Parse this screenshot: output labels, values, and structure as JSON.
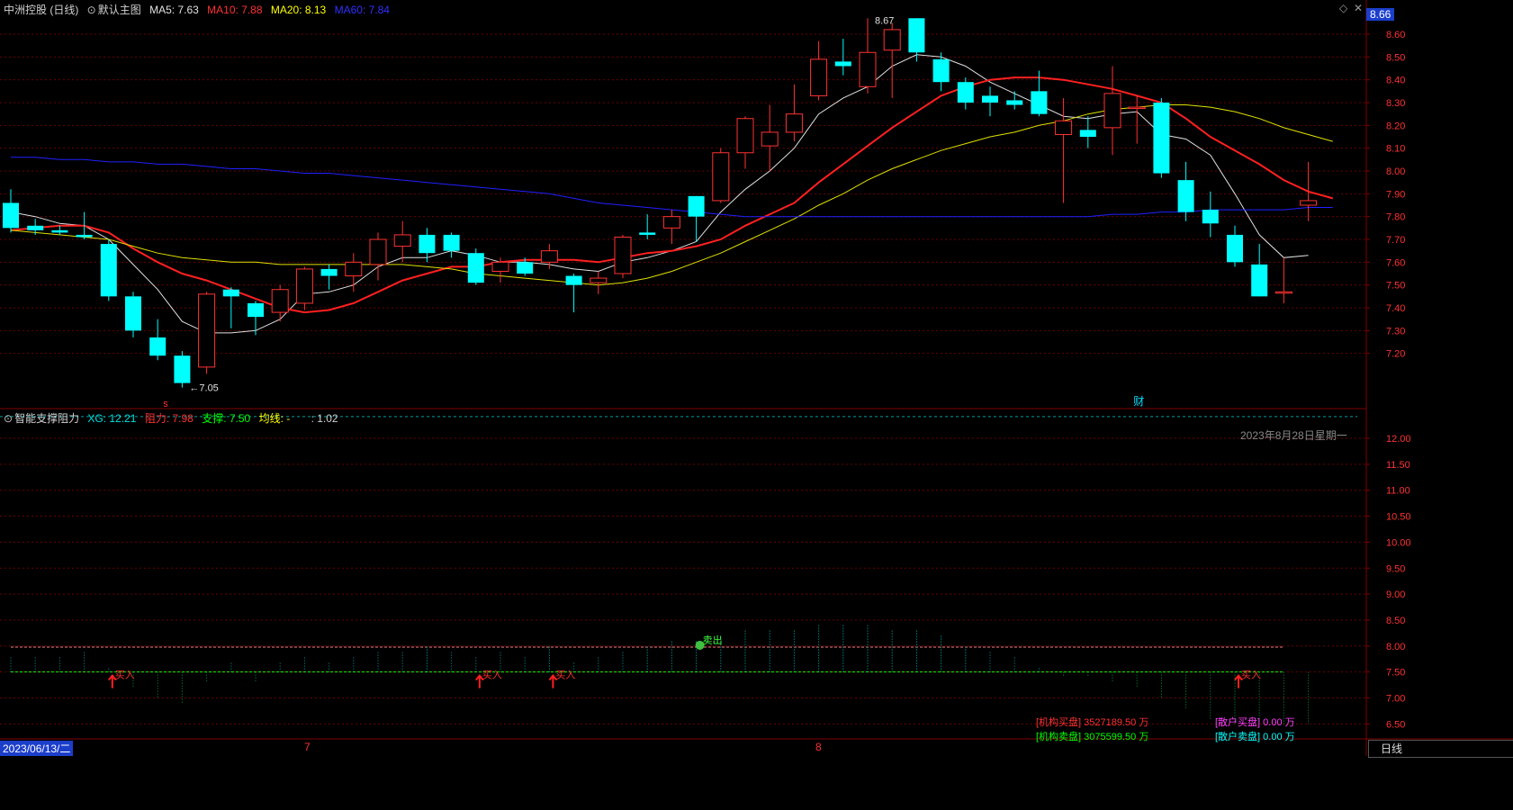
{
  "header": {
    "stock_name": "中洲控股 (日线)",
    "main_chart_label": "默认主图",
    "ma5": "MA5: 7.63",
    "ma10": "MA10: 7.88",
    "ma20": "MA20: 8.13",
    "ma60": "MA60: 7.84",
    "top_right_price": "8.66"
  },
  "indicator": {
    "name": "智能支撑阻力",
    "xg": "XG: 12.21",
    "resistance": "阻力: 7.98",
    "support": "支撑: 7.50",
    "avg": "均线: -",
    "extra": ": 1.02",
    "date_label": "2023年8月28日星期一"
  },
  "bottom": {
    "start_date": "2023/06/13/二",
    "month_7": "7",
    "month_8": "8",
    "period_button": "日线"
  },
  "stats": {
    "inst_buy": "[机构买盘] 3527189.50 万",
    "inst_sell": "[机构卖盘] 3075599.50 万",
    "retail_buy": "[散户买盘] 0.00 万",
    "retail_sell": "[散户卖盘] 0.00 万"
  },
  "annotations": {
    "high": "8.67",
    "low": "7.05",
    "buy": "买入",
    "sell": "卖出",
    "cai": "财",
    "s_mark": "s"
  },
  "colors": {
    "up": "#ff3232",
    "down": "#00ffff",
    "ma5": "#e0e0e0",
    "ma10": "#ff2020",
    "ma20": "#e0e000",
    "ma60": "#2020ff",
    "grid": "#6a0000"
  },
  "chart_data": [
    {
      "type": "candlestick",
      "title": "中洲控股 (日线)",
      "y_ticks": [
        7.2,
        7.3,
        7.4,
        7.5,
        7.6,
        7.7,
        7.8,
        7.9,
        8.0,
        8.1,
        8.2,
        8.3,
        8.4,
        8.5,
        8.6
      ],
      "ylim": [
        7.0,
        8.7
      ],
      "candles": [
        [
          7.86,
          7.75,
          7.92,
          7.73
        ],
        [
          7.76,
          7.74,
          7.79,
          7.72
        ],
        [
          7.74,
          7.73,
          7.76,
          7.72
        ],
        [
          7.72,
          7.71,
          7.82,
          7.7
        ],
        [
          7.68,
          7.45,
          7.7,
          7.43
        ],
        [
          7.45,
          7.3,
          7.47,
          7.27
        ],
        [
          7.27,
          7.19,
          7.35,
          7.17
        ],
        [
          7.19,
          7.07,
          7.21,
          7.05
        ],
        [
          7.14,
          7.46,
          7.47,
          7.11
        ],
        [
          7.48,
          7.45,
          7.49,
          7.31
        ],
        [
          7.42,
          7.36,
          7.43,
          7.28
        ],
        [
          7.38,
          7.48,
          7.5,
          7.34
        ],
        [
          7.42,
          7.57,
          7.58,
          7.39
        ],
        [
          7.57,
          7.54,
          7.59,
          7.48
        ],
        [
          7.54,
          7.6,
          7.64,
          7.47
        ],
        [
          7.59,
          7.7,
          7.73,
          7.52
        ],
        [
          7.67,
          7.72,
          7.78,
          7.6
        ],
        [
          7.72,
          7.64,
          7.75,
          7.6
        ],
        [
          7.72,
          7.65,
          7.73,
          7.62
        ],
        [
          7.64,
          7.51,
          7.66,
          7.5
        ],
        [
          7.56,
          7.6,
          7.62,
          7.51
        ],
        [
          7.6,
          7.55,
          7.62,
          7.54
        ],
        [
          7.6,
          7.65,
          7.68,
          7.57
        ],
        [
          7.54,
          7.5,
          7.55,
          7.38
        ],
        [
          7.51,
          7.53,
          7.56,
          7.46
        ],
        [
          7.55,
          7.71,
          7.72,
          7.53
        ],
        [
          7.73,
          7.72,
          7.81,
          7.7
        ],
        [
          7.75,
          7.8,
          7.83,
          7.68
        ],
        [
          7.89,
          7.8,
          7.89,
          7.69
        ],
        [
          7.87,
          8.08,
          8.1,
          7.86
        ],
        [
          8.08,
          8.23,
          8.24,
          8.01
        ],
        [
          8.11,
          8.17,
          8.29,
          8.0
        ],
        [
          8.17,
          8.25,
          8.38,
          8.13
        ],
        [
          8.33,
          8.49,
          8.57,
          8.31
        ],
        [
          8.48,
          8.46,
          8.58,
          8.42
        ],
        [
          8.37,
          8.52,
          8.67,
          8.34
        ],
        [
          8.53,
          8.62,
          8.65,
          8.32
        ],
        [
          8.67,
          8.52,
          8.67,
          8.48
        ],
        [
          8.49,
          8.39,
          8.52,
          8.35
        ],
        [
          8.39,
          8.3,
          8.41,
          8.27
        ],
        [
          8.33,
          8.3,
          8.37,
          8.24
        ],
        [
          8.31,
          8.29,
          8.35,
          8.27
        ],
        [
          8.35,
          8.25,
          8.44,
          8.24
        ],
        [
          8.16,
          8.22,
          8.32,
          7.86
        ],
        [
          8.18,
          8.15,
          8.24,
          8.1
        ],
        [
          8.19,
          8.34,
          8.46,
          8.07
        ],
        [
          8.28,
          8.28,
          8.33,
          8.12
        ],
        [
          8.3,
          7.99,
          8.32,
          7.97
        ],
        [
          7.96,
          7.82,
          8.04,
          7.78
        ],
        [
          7.83,
          7.77,
          7.91,
          7.71
        ],
        [
          7.72,
          7.6,
          7.76,
          7.58
        ],
        [
          7.59,
          7.45,
          7.68,
          7.45
        ],
        [
          7.47,
          7.47,
          7.62,
          7.42
        ],
        [
          7.85,
          7.87,
          8.04,
          7.78
        ]
      ],
      "series": [
        {
          "name": "MA5",
          "values": [
            7.82,
            7.8,
            7.77,
            7.76,
            7.7,
            7.59,
            7.48,
            7.34,
            7.29,
            7.29,
            7.3,
            7.35,
            7.46,
            7.47,
            7.5,
            7.58,
            7.62,
            7.62,
            7.65,
            7.63,
            7.6,
            7.6,
            7.59,
            7.57,
            7.56,
            7.6,
            7.62,
            7.65,
            7.69,
            7.82,
            7.92,
            8.0,
            8.1,
            8.25,
            8.32,
            8.37,
            8.46,
            8.51,
            8.5,
            8.46,
            8.39,
            8.34,
            8.29,
            8.24,
            8.23,
            8.25,
            8.26,
            8.16,
            8.14,
            8.07,
            7.9,
            7.72,
            7.62,
            7.63
          ]
        },
        {
          "name": "MA10",
          "values": [
            7.74,
            7.75,
            7.76,
            7.76,
            7.73,
            7.66,
            7.6,
            7.55,
            7.52,
            7.48,
            7.44,
            7.4,
            7.38,
            7.39,
            7.42,
            7.47,
            7.52,
            7.55,
            7.58,
            7.58,
            7.6,
            7.61,
            7.61,
            7.61,
            7.6,
            7.62,
            7.64,
            7.65,
            7.67,
            7.7,
            7.76,
            7.81,
            7.86,
            7.95,
            8.03,
            8.11,
            8.19,
            8.26,
            8.33,
            8.37,
            8.4,
            8.41,
            8.41,
            8.4,
            8.38,
            8.36,
            8.33,
            8.3,
            8.23,
            8.15,
            8.09,
            8.03,
            7.96,
            7.91,
            7.88
          ]
        },
        {
          "name": "MA20",
          "values": [
            7.74,
            7.73,
            7.72,
            7.71,
            7.7,
            7.67,
            7.64,
            7.62,
            7.61,
            7.6,
            7.6,
            7.59,
            7.59,
            7.59,
            7.59,
            7.59,
            7.59,
            7.58,
            7.57,
            7.55,
            7.54,
            7.53,
            7.52,
            7.51,
            7.5,
            7.51,
            7.53,
            7.56,
            7.6,
            7.64,
            7.69,
            7.74,
            7.79,
            7.85,
            7.9,
            7.96,
            8.01,
            8.05,
            8.09,
            8.12,
            8.15,
            8.17,
            8.2,
            8.22,
            8.25,
            8.27,
            8.28,
            8.29,
            8.29,
            8.28,
            8.26,
            8.23,
            8.19,
            8.16,
            8.13
          ]
        },
        {
          "name": "MA60",
          "values": [
            8.06,
            8.06,
            8.05,
            8.05,
            8.04,
            8.04,
            8.03,
            8.03,
            8.02,
            8.01,
            8.01,
            8.0,
            7.99,
            7.99,
            7.98,
            7.97,
            7.96,
            7.95,
            7.94,
            7.93,
            7.92,
            7.91,
            7.9,
            7.88,
            7.86,
            7.85,
            7.84,
            7.83,
            7.82,
            7.81,
            7.8,
            7.8,
            7.8,
            7.8,
            7.8,
            7.8,
            7.8,
            7.8,
            7.8,
            7.8,
            7.8,
            7.8,
            7.8,
            7.8,
            7.8,
            7.81,
            7.81,
            7.82,
            7.82,
            7.83,
            7.83,
            7.83,
            7.83,
            7.84,
            7.84
          ]
        }
      ]
    },
    {
      "type": "bar",
      "title": "智能支撑阻力",
      "y_ticks": [
        6.5,
        7.0,
        7.5,
        8.0,
        8.5,
        9.0,
        9.5,
        10.0,
        10.5,
        11.0,
        11.5,
        12.0
      ],
      "ylim": [
        6.3,
        12.6
      ],
      "resistance": 7.98,
      "support": 7.5,
      "xg": 12.21,
      "values": [
        7.8,
        7.8,
        7.8,
        7.9,
        7.6,
        7.2,
        7.0,
        6.9,
        7.3,
        7.7,
        7.3,
        7.7,
        7.8,
        7.7,
        7.8,
        7.9,
        7.9,
        8.0,
        7.9,
        7.8,
        7.9,
        7.8,
        8.0,
        7.7,
        7.8,
        7.9,
        8.0,
        8.1,
        8.1,
        8.2,
        8.3,
        8.3,
        8.3,
        8.4,
        8.4,
        8.4,
        8.3,
        8.3,
        8.2,
        8.0,
        7.9,
        7.8,
        7.6,
        7.4,
        7.4,
        7.3,
        7.2,
        7.0,
        6.8,
        6.6,
        6.5,
        6.5,
        6.5,
        6.5
      ],
      "buy_signals_at": [
        4,
        19,
        22,
        50
      ],
      "sell_signals_at": [
        28
      ]
    }
  ]
}
